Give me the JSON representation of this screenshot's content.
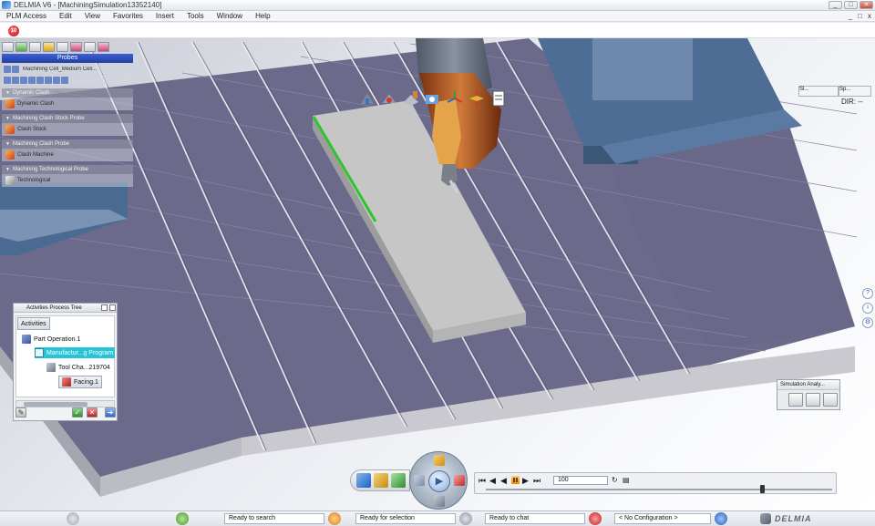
{
  "window": {
    "title": "DELMIA V6 - [MachiningSimulation13352140]",
    "minimize_glyph": "_",
    "maximize_glyph": "□",
    "close_glyph": "✕"
  },
  "menu": {
    "items": [
      "PLM Access",
      "Edit",
      "View",
      "Favorites",
      "Insert",
      "Tools",
      "Window",
      "Help"
    ],
    "mdi_controls": [
      "_",
      "□",
      "x"
    ]
  },
  "compass": {
    "label": "10"
  },
  "machining_panel": {
    "probes_label": "Probes",
    "cell_label": "Machining Cell_Medium Cell...",
    "sections": [
      {
        "header": "Dynamic Clash",
        "item": "Dynamic Clash",
        "icon": "clash-icon"
      },
      {
        "header": "Machining Clash Stock Probe",
        "item": "Clash Stock",
        "icon": "clash-stock-icon"
      },
      {
        "header": "Machining Clash Probe",
        "item": "Clash Machine",
        "icon": "clash-machine-icon"
      },
      {
        "header": "Machining Technological Probe",
        "item": "Technological",
        "icon": "technological-icon"
      }
    ]
  },
  "activities_tree": {
    "title": "Activities Process Tree",
    "root_label": "Activities",
    "nodes": [
      {
        "label": "Part Operation.1",
        "level": 1
      },
      {
        "label": "Manufactur...g Program",
        "level": 2,
        "selected": true
      },
      {
        "label": "Tool Cha...219704",
        "level": 3
      },
      {
        "label": "Facing.1",
        "level": 4
      }
    ]
  },
  "top_icons": [
    "machine-view-icon",
    "tool-view-icon",
    "stock-view-icon",
    "video-icon",
    "axis-icon",
    "compass-axis-icon",
    "report-icon"
  ],
  "right_panels": {
    "panel1_label": "Sl...",
    "panel2_label": "Sp...",
    "dir_label": "DIR: --"
  },
  "simulation_panel": {
    "title": "Simulation Analy..."
  },
  "player": {
    "frame_value": "100",
    "controls": [
      "⏮",
      "◀",
      "▶",
      "⏭"
    ]
  },
  "status": {
    "search": "Ready to search",
    "selection": "Ready for selection",
    "chat": "Ready to chat",
    "configuration": "< No Configuration >",
    "brand": "DELMIA"
  },
  "colors": {
    "table_purple": "#6c6a8a",
    "stock_face": "#c4c4c4",
    "spindle": "#b85a1c",
    "accent_blue": "#2a6acb",
    "highlight_cyan": "#27c4d6",
    "edge_green": "#2cc52c"
  }
}
